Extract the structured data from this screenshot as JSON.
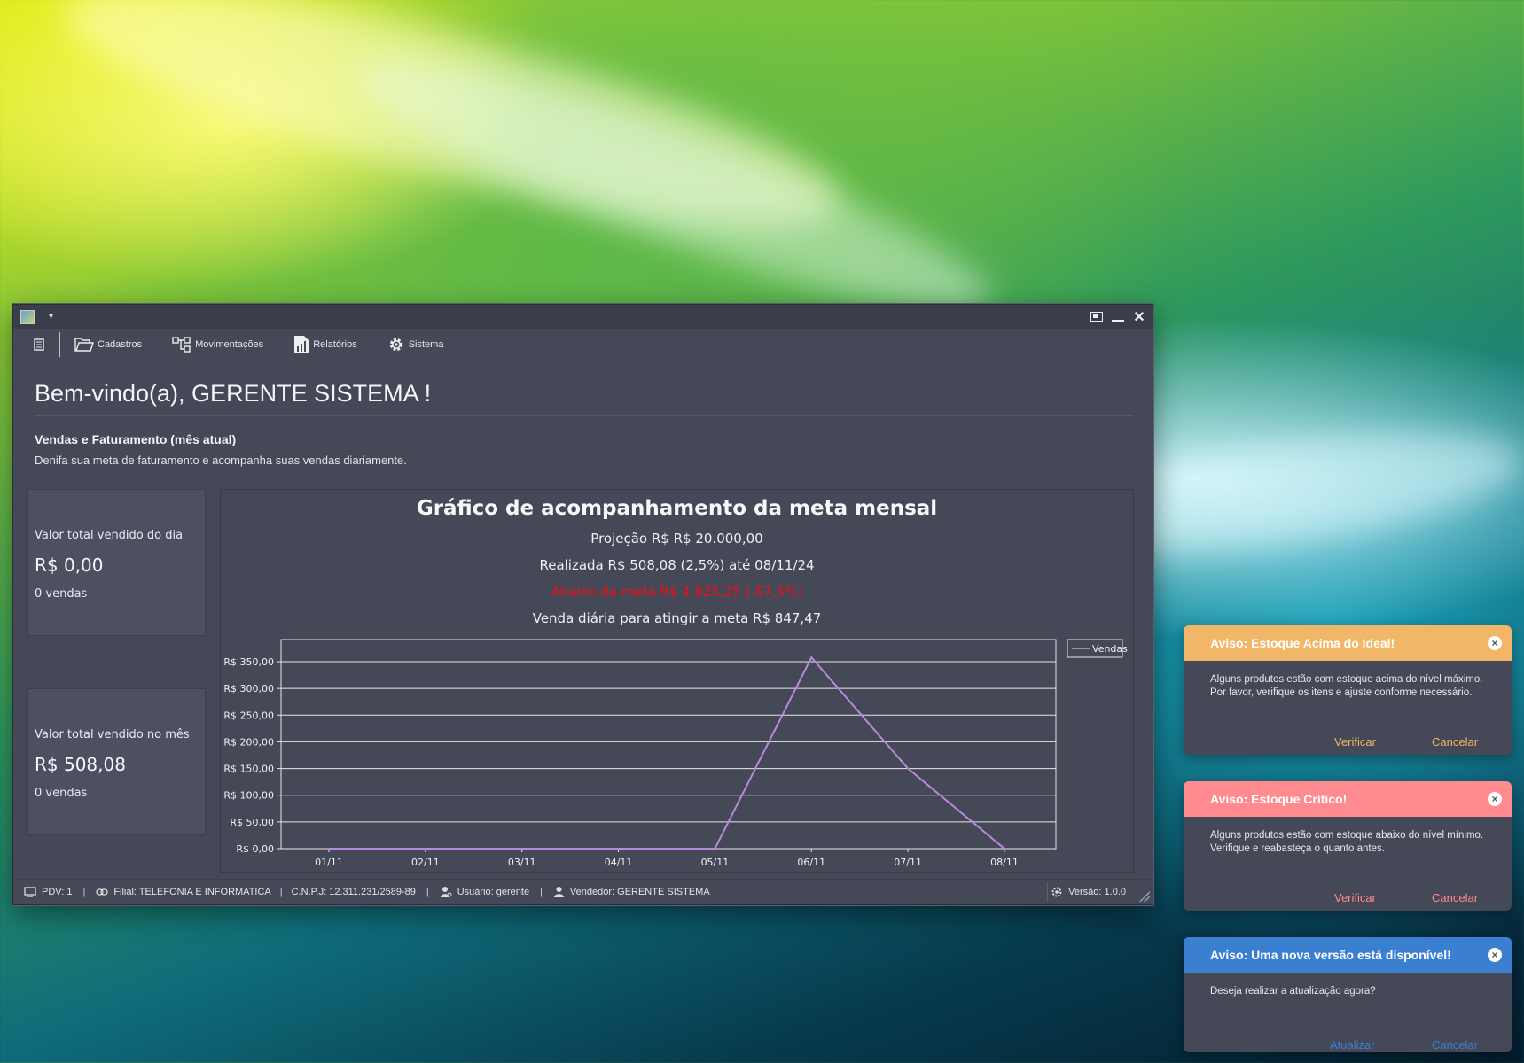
{
  "menu": {
    "items": [
      {
        "label": "Cadastros",
        "icon": "folder-icon"
      },
      {
        "label": "Movimentações",
        "icon": "flow-icon"
      },
      {
        "label": "Relatórios",
        "icon": "report-icon"
      },
      {
        "label": "Sistema",
        "icon": "gear-icon"
      }
    ]
  },
  "welcome": "Bem-vindo(a), GERENTE SISTEMA !",
  "section": {
    "title": "Vendas e Faturamento (mês atual)",
    "subtitle": "Denifa sua meta de faturamento e acompanha suas vendas diariamente."
  },
  "cards": {
    "day": {
      "label": "Valor total vendido do dia",
      "value": "R$ 0,00",
      "count": "0 vendas"
    },
    "month": {
      "label": "Valor total vendido no mês",
      "value": "R$ 508,08",
      "count": "0 vendas"
    }
  },
  "chart_data": {
    "type": "line",
    "title": "Gráfico de acompanhamento da meta mensal",
    "subtitles": [
      "Projeção R$ R$ 20.000,00",
      "Realizada R$ 508,08 (2,5%) até 08/11/24",
      "Abaixo da meta R$ 4.825,25 (-97,5%)",
      "Venda diária para atingir a meta R$ 847,47"
    ],
    "warning_color": "#e8101a",
    "line_color": "#b98ad8",
    "categories": [
      "01/11",
      "02/11",
      "03/11",
      "04/11",
      "05/11",
      "06/11",
      "07/11",
      "08/11"
    ],
    "series": [
      {
        "name": "Vendas",
        "values": [
          0,
          0,
          0,
          0,
          0,
          358,
          150,
          0
        ]
      }
    ],
    "y_ticks": [
      "R$ 0,00",
      "R$ 50,00",
      "R$ 100,00",
      "R$ 150,00",
      "R$ 200,00",
      "R$ 250,00",
      "R$ 300,00",
      "R$ 350,00"
    ],
    "ylim": [
      0,
      350
    ],
    "grid": true,
    "legend": "top-right"
  },
  "status": {
    "pdv": "PDV: 1",
    "filial": "Filial: TELEFONIA E INFORMATICA",
    "cnpj": "C.N.P.J: 12.311.231/2589-89",
    "usuario": "Usuário: gerente",
    "vendedor": "Vendedor: GERENTE SISTEMA",
    "versao": "Versão: 1.0.0"
  },
  "toasts": [
    {
      "title": "Aviso: Estoque Acima do Ideal!",
      "body": "Alguns produtos estão com estoque acima do nível máximo. Por favor, verifique os itens e ajuste conforme necessário.",
      "primary": "Verificar",
      "secondary": "Cancelar",
      "color": "#f1b667"
    },
    {
      "title": "Aviso: Estoque Crítico!",
      "body": "Alguns produtos estão com estoque abaixo do nível mínimo. Verifique e reabasteça o quanto antes.",
      "primary": "Verificar",
      "secondary": "Cancelar",
      "color": "#ff8a8f"
    },
    {
      "title": "Aviso: Uma nova versão está disponível!",
      "body": "Deseja realizar a atualização agora?",
      "primary": "Atualizar",
      "secondary": "Cancelar",
      "color": "#3a7fd0"
    }
  ]
}
